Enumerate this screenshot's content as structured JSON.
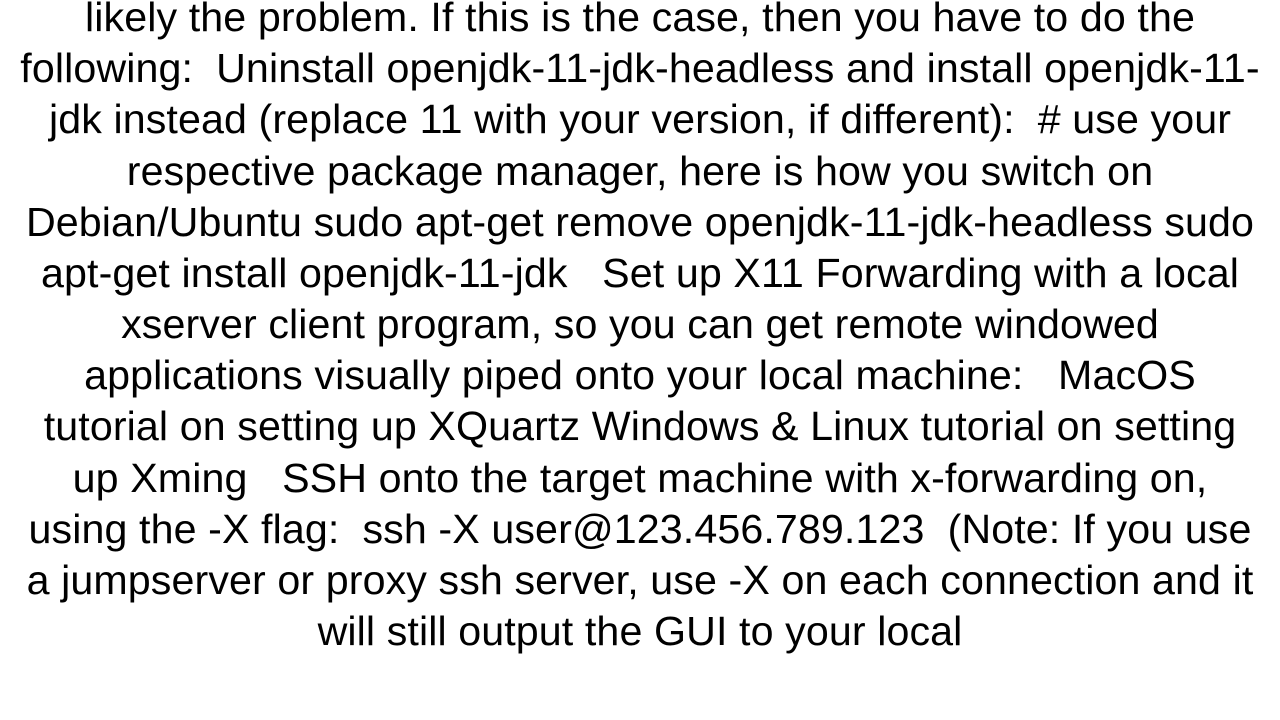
{
  "body_text": "likely the problem. If this is the case, then you have to do the following:  Uninstall openjdk-11-jdk-headless and install openjdk-11-jdk instead (replace 11 with your version, if different):  # use your respective package manager, here is how you switch on Debian/Ubuntu sudo apt-get remove openjdk-11-jdk-headless sudo apt-get install openjdk-11-jdk   Set up X11 Forwarding with a local xserver client program, so you can get remote windowed applications visually piped onto your local machine:   MacOS tutorial on setting up XQuartz Windows & Linux tutorial on setting up Xming   SSH onto the target machine with x-forwarding on, using the -X flag:  ssh -X user@123.456.789.123  (Note: If you use a jumpserver or proxy ssh server, use -X on each connection and it will still output the GUI to your local"
}
